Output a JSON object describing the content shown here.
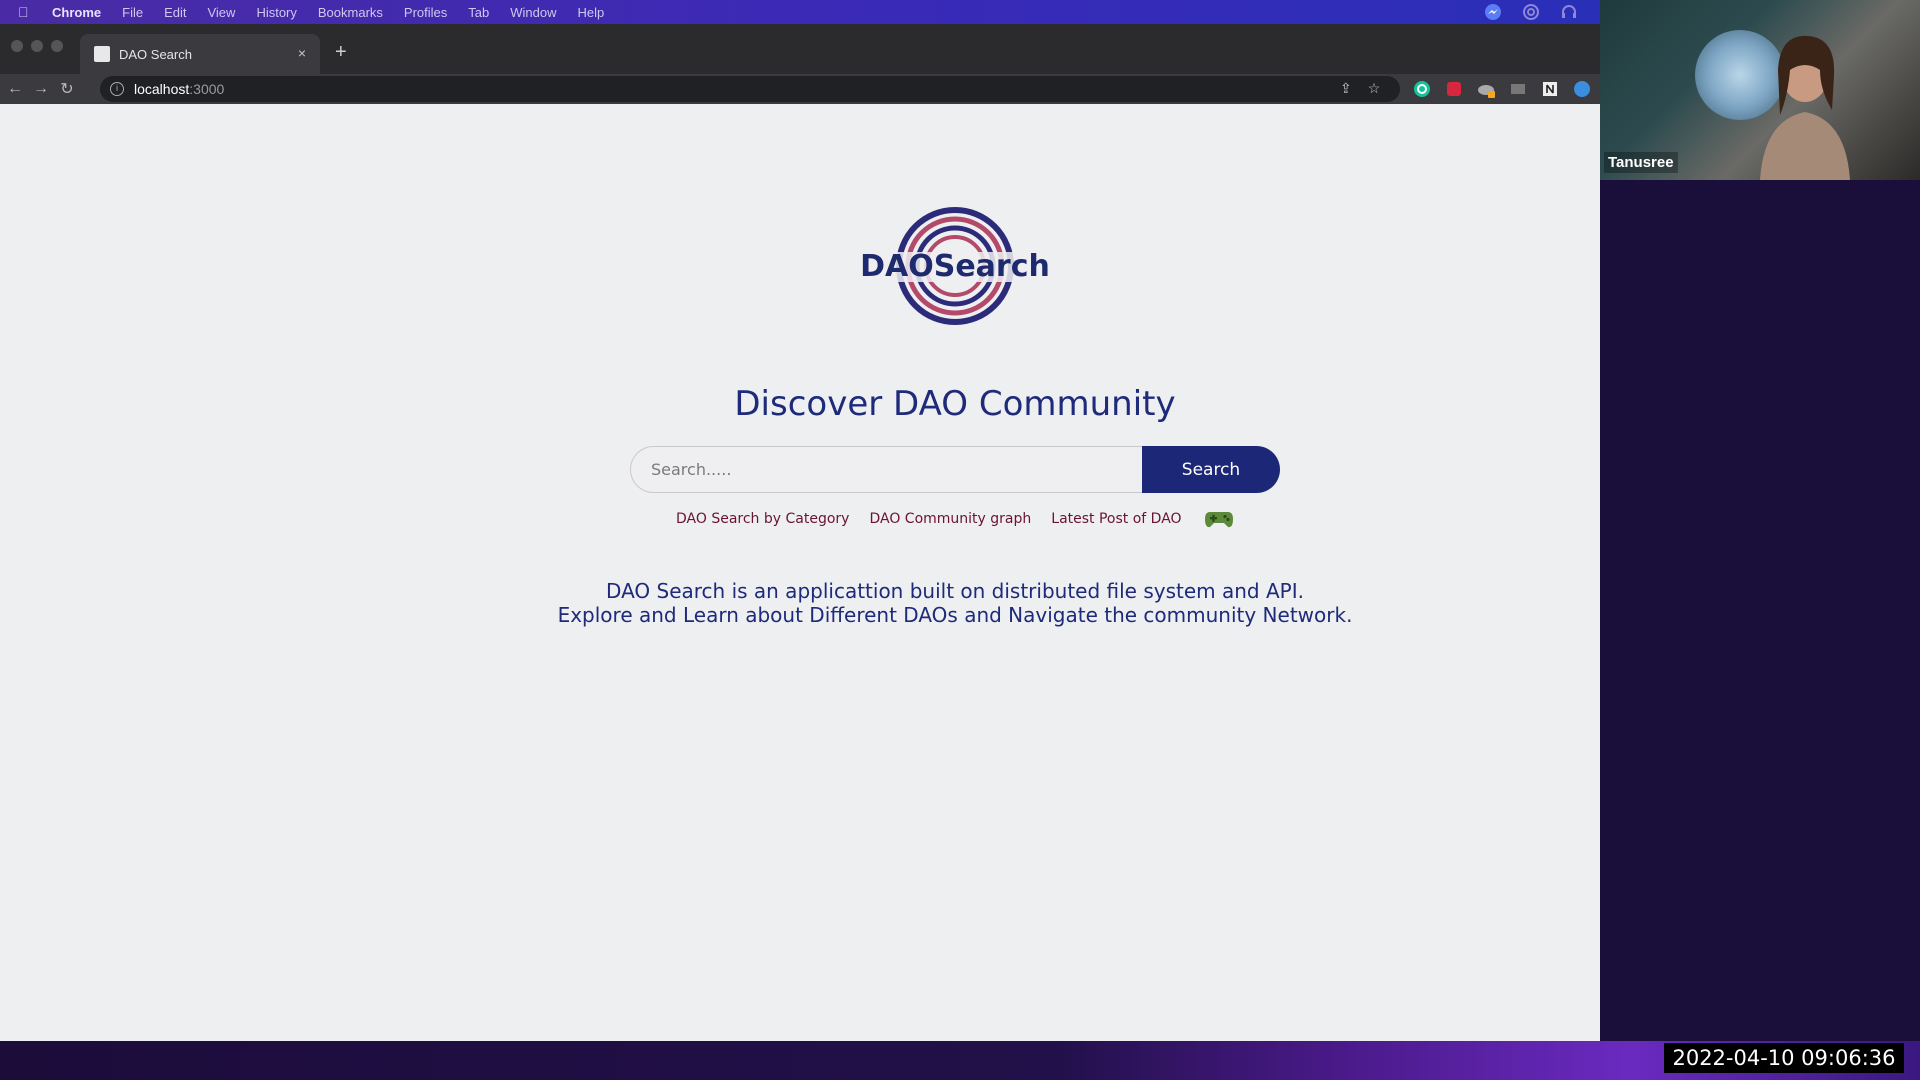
{
  "menubar": {
    "items": [
      "Chrome",
      "File",
      "Edit",
      "View",
      "History",
      "Bookmarks",
      "Profiles",
      "Tab",
      "Window",
      "Help"
    ]
  },
  "browser": {
    "tab_title": "DAO Search",
    "new_tab": "+",
    "close_tab": "×",
    "url_host": "localhost",
    "url_port": ":3000",
    "back": "←",
    "forward": "→",
    "reload": "↻"
  },
  "page": {
    "logo_text": "DAOSearch",
    "headline": "Discover DAO Community",
    "search_placeholder": "Search.....",
    "search_button": "Search",
    "links": [
      "DAO Search by Category",
      "DAO Community graph",
      "Latest Post of DAO"
    ],
    "description_line1": "DAO Search is an applicattion built on distributed file system and API.",
    "description_line2": "Explore and Learn about Different DAOs and Navigate the community Network."
  },
  "overlay": {
    "participant_name": "Tanusree",
    "timestamp": "2022-04-10  09:06:36"
  },
  "colors": {
    "accent": "#1d2778",
    "link": "#6b1330",
    "page_bg": "#eeeff1"
  }
}
